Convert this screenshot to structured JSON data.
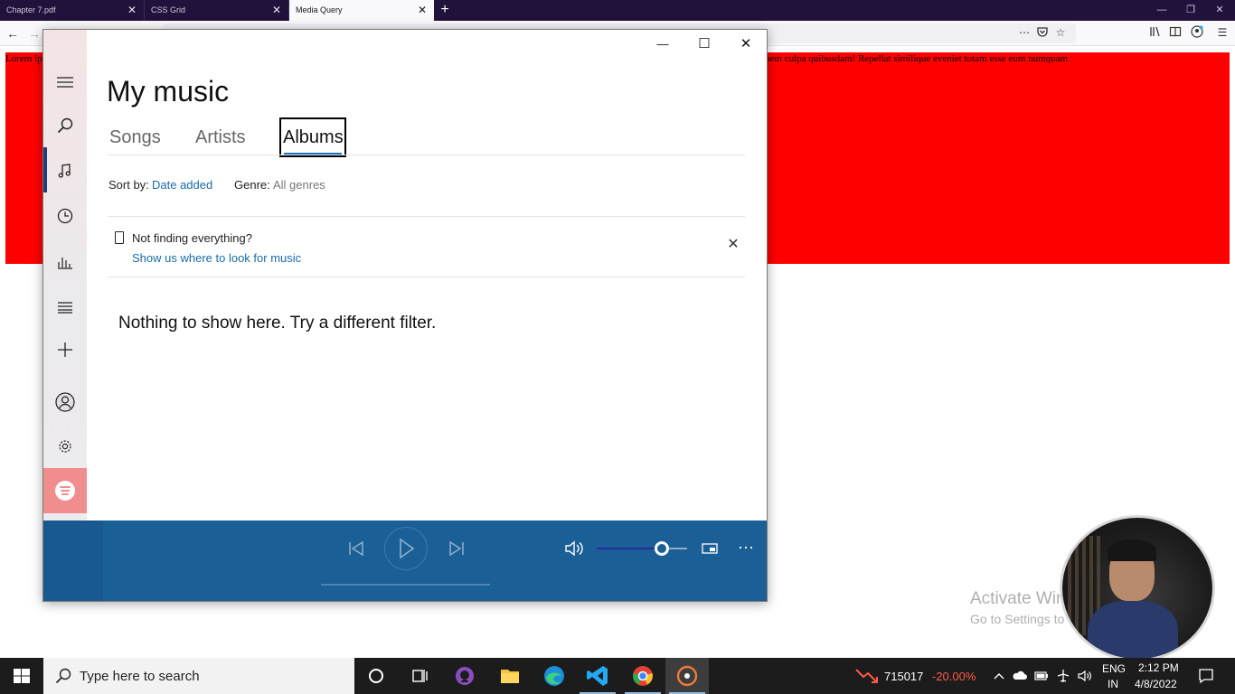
{
  "browser": {
    "tabs": [
      {
        "title": "Chapter 7.pdf",
        "close": "✕"
      },
      {
        "title": "CSS Grid",
        "close": "✕"
      },
      {
        "title": "Media Query",
        "close": "✕"
      }
    ],
    "new_tab": "+",
    "window_controls": {
      "minimize": "—",
      "restore": "❐",
      "close": "✕"
    },
    "nav": {
      "back": "←",
      "forward": "→"
    },
    "toolbar_icons": [
      "more-icon",
      "pocket-icon",
      "bookmark-star-icon",
      "library-icon",
      "reader-view-icon",
      "account-icon",
      "menu-icon"
    ]
  },
  "webpage": {
    "paragraph_left": "Lorem ip",
    "paragraph_right": "nem culpa quibusdam! Repellat similique eveniet totam esse eum numquam",
    "box_color": "#ff0000"
  },
  "groove": {
    "window_controls": {
      "minimize": "—",
      "maximize": "☐",
      "close": "✕"
    },
    "sidebar_icons": [
      "hamburger-icon",
      "search-icon",
      "music-note-icon",
      "recent-clock-icon",
      "now-playing-icon",
      "playlists-icon",
      "add-icon",
      "account-icon",
      "settings-gear-icon",
      "spotify-icon"
    ],
    "title": "My music",
    "tabs": [
      {
        "label": "Songs",
        "selected": false
      },
      {
        "label": "Artists",
        "selected": false
      },
      {
        "label": "Albums",
        "selected": true
      }
    ],
    "sort_label": "Sort by:",
    "sort_value": "Date added",
    "genre_label": "Genre:",
    "genre_value": "All genres",
    "notice_title": "Not finding everything?",
    "notice_link": "Show us where to look for music",
    "notice_close": "✕",
    "empty_message": "Nothing to show here. Try a different filter.",
    "player": {
      "volume_level": 0.72,
      "accent": "#1a5f96"
    }
  },
  "watermark": {
    "line1": "Activate Windows",
    "line2": "Go to Settings to activate Windows."
  },
  "taskbar": {
    "search_placeholder": "Type here to search",
    "pinned": [
      "cortana-icon",
      "task-view-icon",
      "github-desktop-icon",
      "file-explorer-icon",
      "edge-icon",
      "vscode-icon",
      "chrome-icon",
      "groove-music-icon"
    ],
    "stock_value": "715017",
    "stock_change": "-20.00%",
    "language_line1": "ENG",
    "language_line2": "IN",
    "time": "2:12 PM",
    "date": "4/8/2022"
  }
}
